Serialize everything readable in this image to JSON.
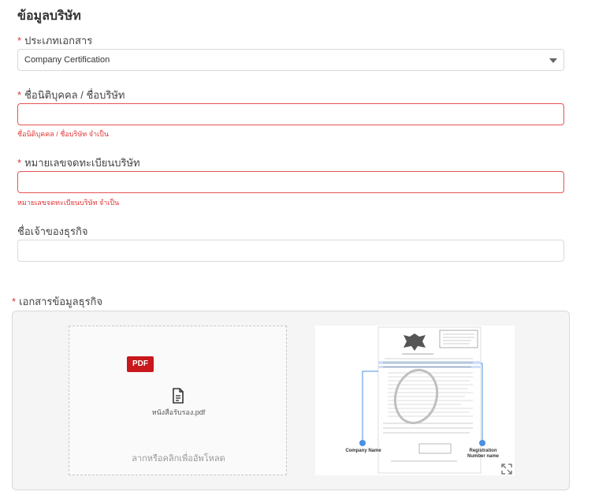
{
  "section": {
    "title": "ข้อมูลบริษัท"
  },
  "required_mark": "*",
  "fields": {
    "doc_type": {
      "label": "ประเภทเอกสาร",
      "value": "Company Certification"
    },
    "company_name": {
      "label": "ชื่อนิติบุคคล / ชื่อบริษัท",
      "value": "",
      "error": "ชื่อนิติบุคคล / ชื่อบริษัท จำเป็น"
    },
    "reg_number": {
      "label": "หมายเลขจดทะเบียนบริษัท",
      "value": "",
      "error": "หมายเลขจดทะเบียนบริษัท จำเป็น"
    },
    "owner_name": {
      "label": "ชื่อเจ้าของธุรกิจ",
      "value": ""
    }
  },
  "upload": {
    "label": "เอกสารข้อมูลธุรกิจ",
    "file_type_badge": "PDF",
    "file_name": "หนังสือรับรอง.pdf",
    "drop_hint": "ลากหรือคลิกเพื่ออัพโหลด",
    "example": {
      "left_label_1": "Company Name",
      "right_label_1": "Registration",
      "right_label_2": "Number name"
    }
  },
  "colors": {
    "required": "#e03535",
    "error_border": "#e55353",
    "pdf_badge": "#c8171d",
    "highlight": "#4a90e2"
  },
  "icons": {
    "caret": "chevron-down-icon",
    "file": "document-icon",
    "expand": "expand-icon",
    "emblem": "garuda-emblem-icon"
  }
}
